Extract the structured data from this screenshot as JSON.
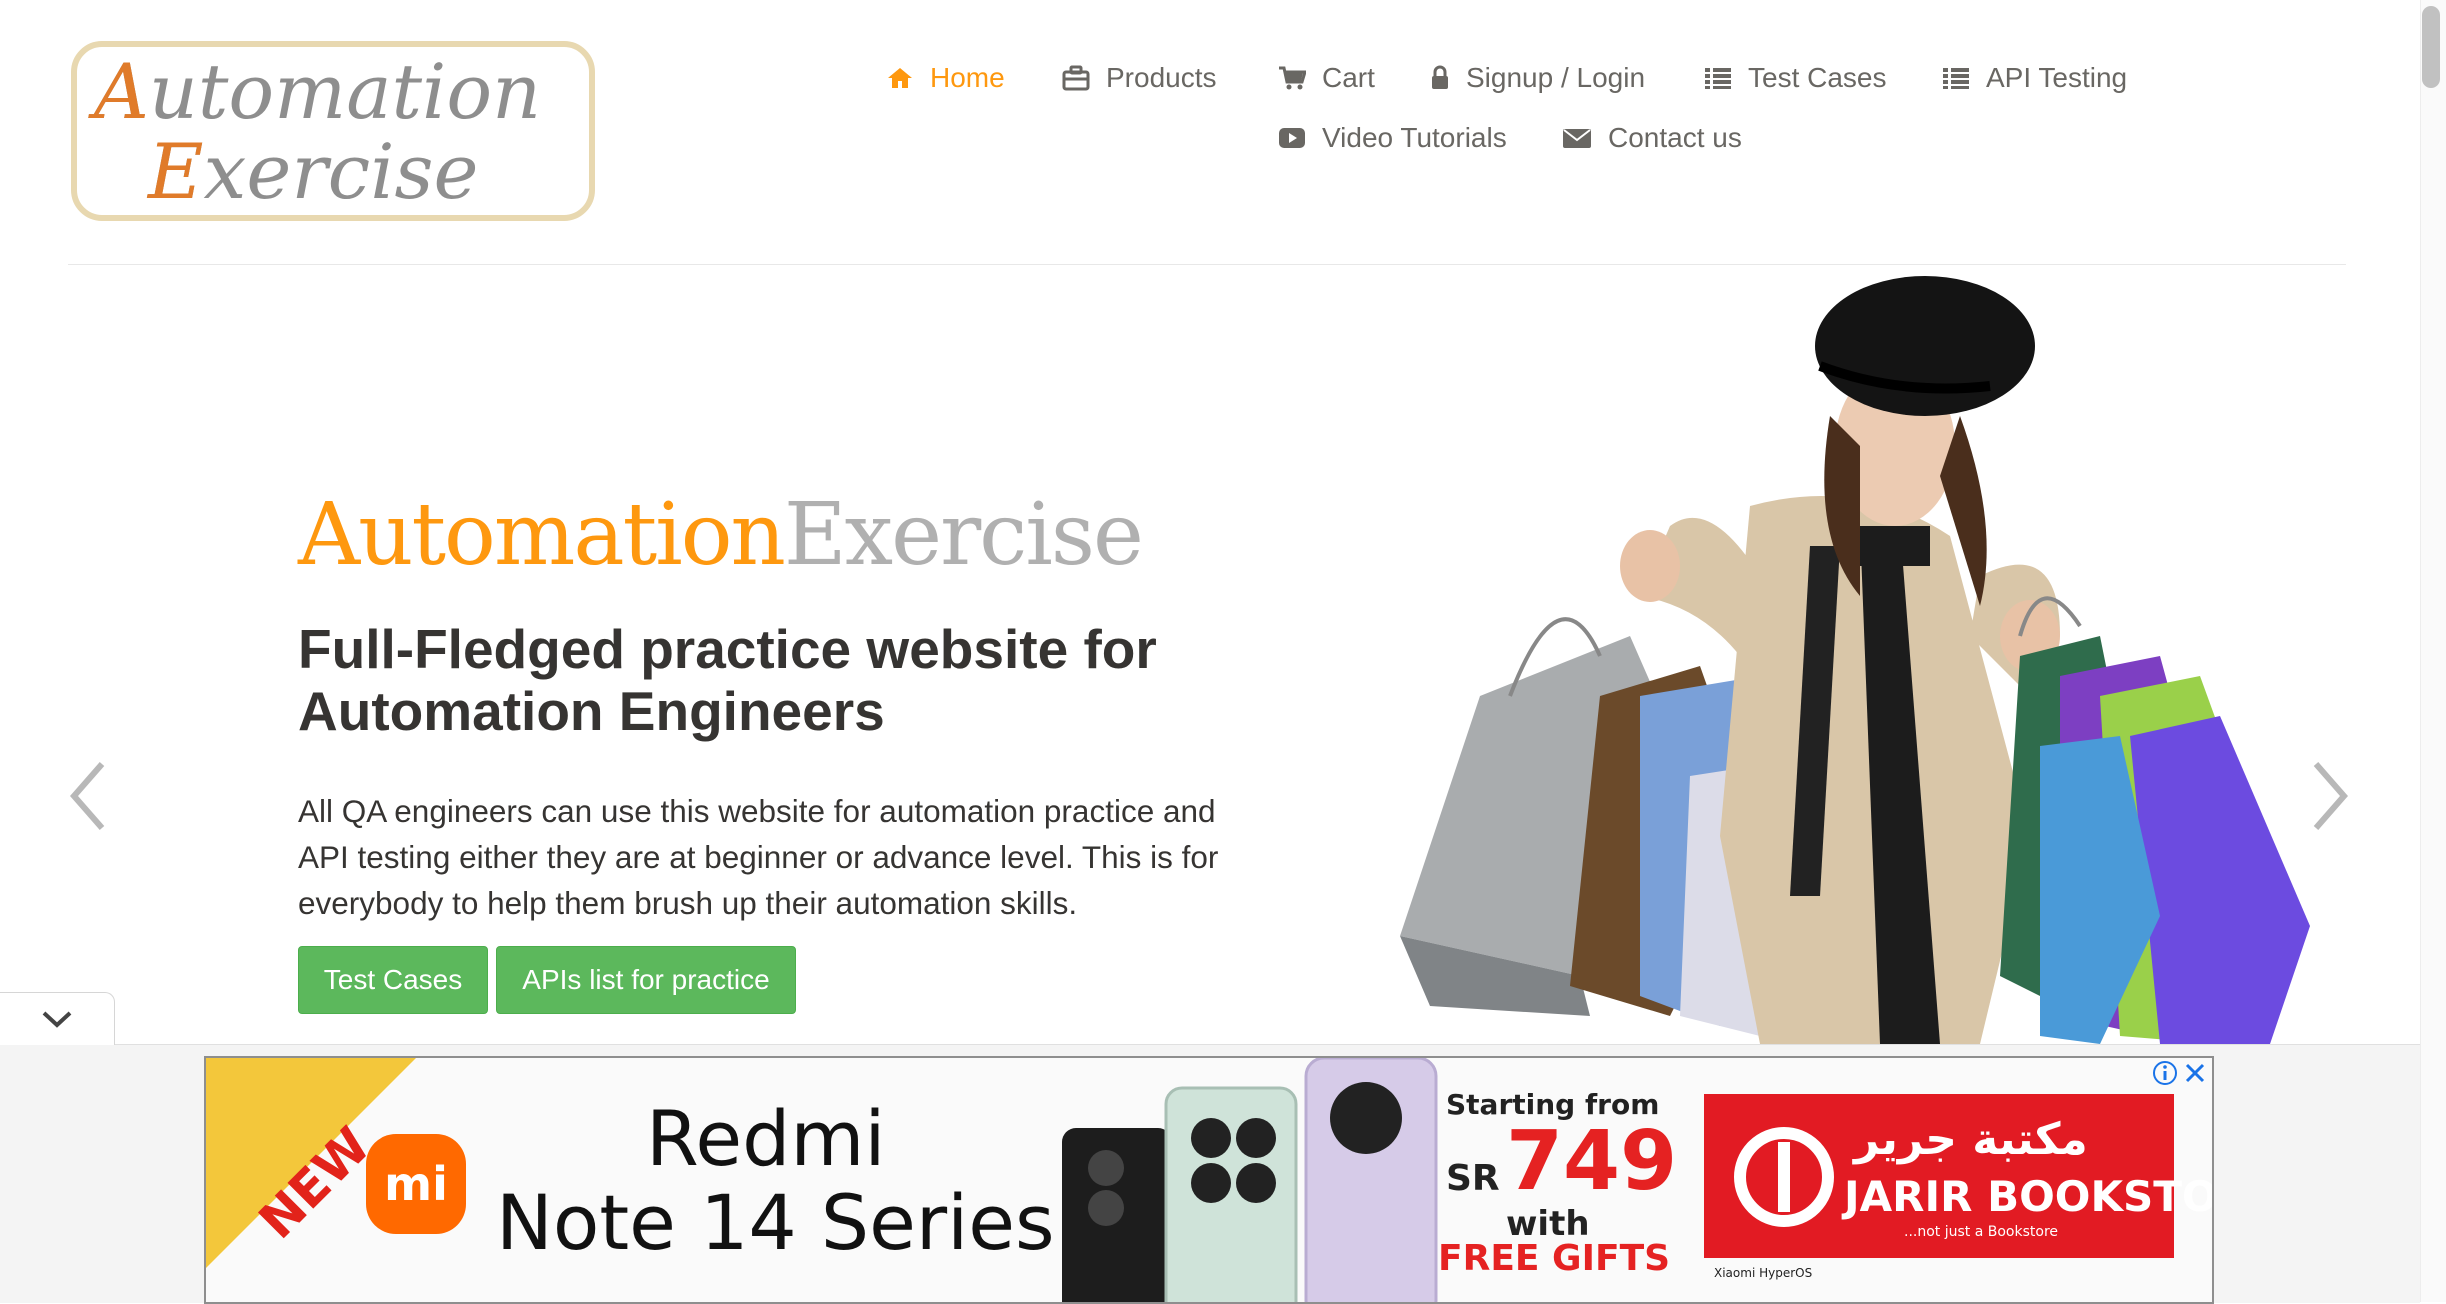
{
  "brand": {
    "logo_line1": "Automation",
    "logo_line2": "Exercise",
    "primary_color": "#FE980F"
  },
  "nav": {
    "items": [
      {
        "label": "Home",
        "icon": "home-icon",
        "active": true
      },
      {
        "label": "Products",
        "icon": "briefcase-icon"
      },
      {
        "label": "Cart",
        "icon": "cart-icon"
      },
      {
        "label": "Signup / Login",
        "icon": "lock-icon"
      },
      {
        "label": "Test Cases",
        "icon": "list-icon"
      },
      {
        "label": "API Testing",
        "icon": "list-icon"
      },
      {
        "label": "Video Tutorials",
        "icon": "youtube-play-icon"
      },
      {
        "label": "Contact us",
        "icon": "envelope-icon"
      }
    ]
  },
  "hero": {
    "title_part1": "Automation",
    "title_part2": "Exercise",
    "heading": "Full-Fledged practice website for Automation Engineers",
    "description": "All QA engineers can use this website for automation practice and API testing either they are at beginner or advance level. This is for everybody to help them brush up their automation skills.",
    "button_test_cases": "Test Cases",
    "button_apis": "APIs list for practice",
    "button_color": "#5CB85C"
  },
  "ad": {
    "badge": "NEW",
    "brand_mark": "mi",
    "title_line1": "Redmi",
    "title_line2": "Note 14 Series",
    "starting_from": "Starting from",
    "currency": "SR",
    "price": "749",
    "with": "with",
    "free_gifts": "FREE GIFTS",
    "store_arabic": "مكتبة جرير",
    "store_name": "JARIR BOOKSTORE",
    "store_tagline": "...not just a Bookstore",
    "powered": "Xiaomi HyperOS"
  }
}
